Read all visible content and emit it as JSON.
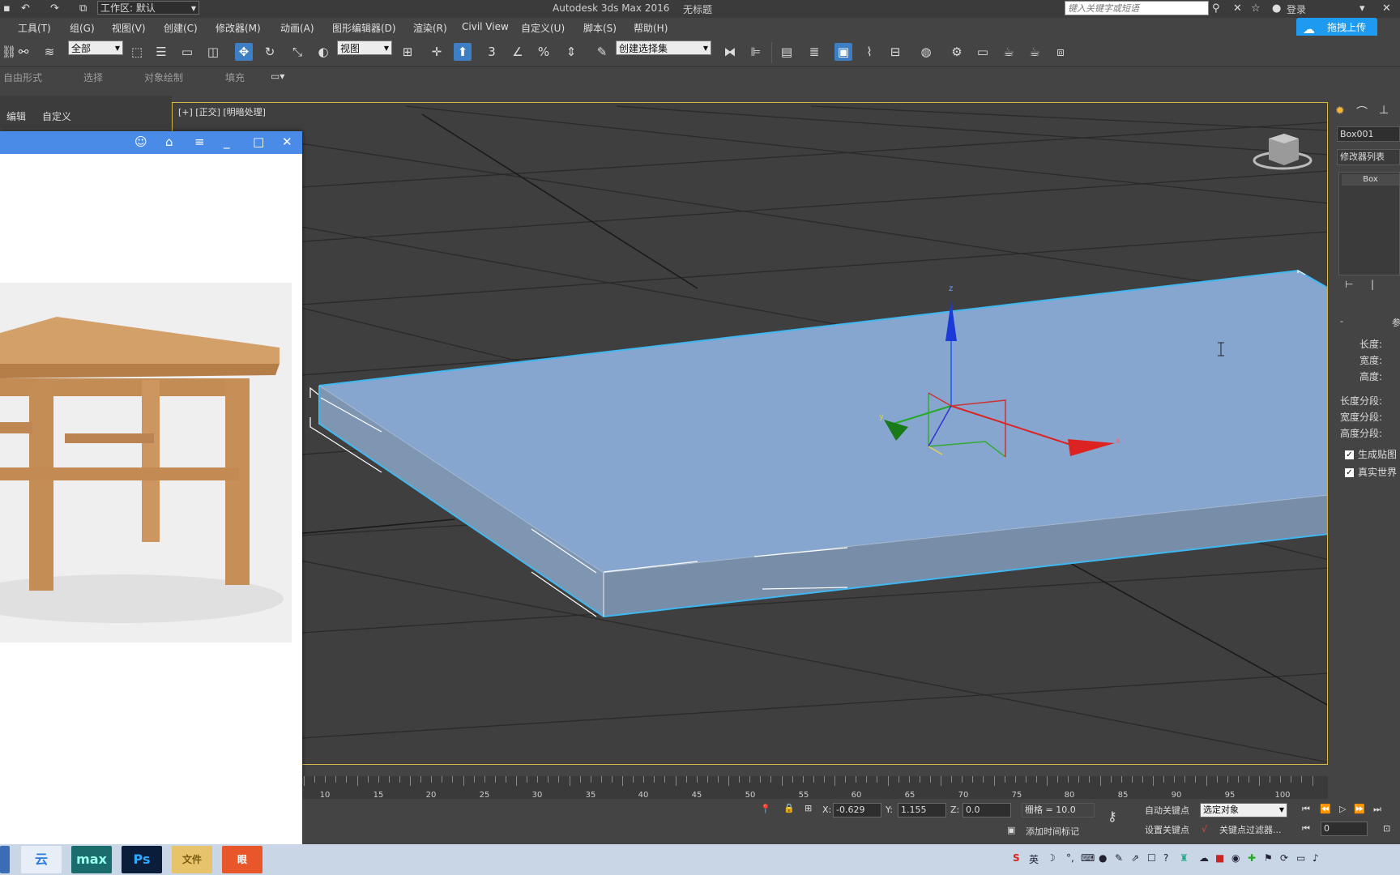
{
  "titlebar": {
    "workspace_label": "工作区: 默认",
    "app_title": "Autodesk 3ds Max 2016",
    "doc_title": "无标题",
    "search_placeholder": "键入关键字或短语",
    "login_label": "登录"
  },
  "menubar": {
    "items": [
      "工具(T)",
      "组(G)",
      "视图(V)",
      "创建(C)",
      "修改器(M)",
      "动画(A)",
      "图形编辑器(D)",
      "渲染(R)",
      "Civil View",
      "自定义(U)",
      "脚本(S)",
      "帮助(H)"
    ],
    "upload_label": "拖拽上传"
  },
  "toolbar": {
    "filter_select": "全部",
    "coord_select": "视图",
    "selection_set_placeholder": "创建选择集",
    "snap_label": "3",
    "percent_label": "%"
  },
  "ribbon": {
    "tabs": [
      "自由形式",
      "选择",
      "对象绘制",
      "填充"
    ]
  },
  "left_panel": {
    "tabs": [
      "编辑",
      "自定义"
    ]
  },
  "viewport": {
    "label": "[+] [正交] [明暗处理]",
    "object_color": "#86a6d0",
    "selection_color": "#3fb7f0",
    "axis_x": "x",
    "axis_y": "y",
    "axis_z": "z"
  },
  "right_panel": {
    "object_name": "Box001",
    "modifier_list": "修改器列表",
    "stack_item": "Box",
    "rollout_title": "参",
    "params": [
      "长度:",
      "宽度:",
      "高度:",
      "长度分段:",
      "宽度分段:",
      "高度分段:"
    ],
    "checks": [
      "生成贴图",
      "真实世界"
    ]
  },
  "timeline": {
    "labels": [
      "10",
      "15",
      "20",
      "25",
      "30",
      "35",
      "40",
      "45",
      "50",
      "55",
      "60",
      "65",
      "70",
      "75",
      "80",
      "85",
      "90",
      "95",
      "100"
    ]
  },
  "statusbar": {
    "x_label": "X:",
    "x_value": "-0.629",
    "y_label": "Y:",
    "y_value": "1.155",
    "z_label": "Z:",
    "z_value": "0.0",
    "grid": "栅格 = 10.0",
    "add_time_tag": "添加时间标记",
    "auto_key": "自动关键点",
    "set_key": "设置关键点",
    "selected_object": "选定对象",
    "key_filter": "关键点过滤器...",
    "frame_value": "0"
  },
  "taskbar": {
    "apps": [
      "云",
      "max",
      "Ps",
      "文件",
      "眼"
    ],
    "tray_lang": "英"
  }
}
